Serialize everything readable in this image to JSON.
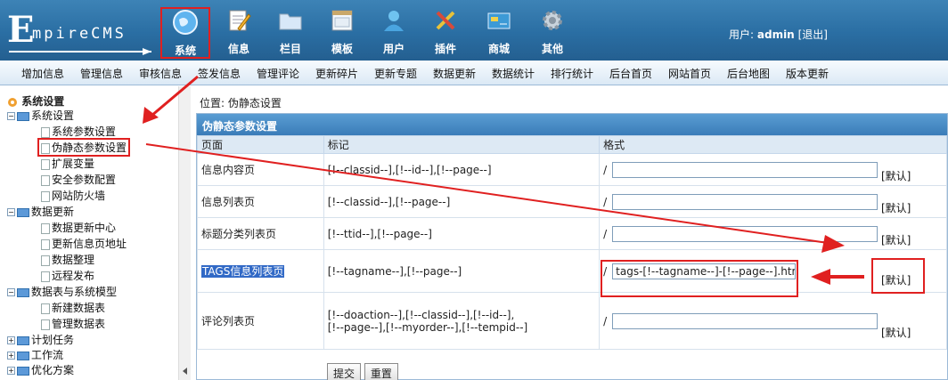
{
  "header": {
    "logo_initial": "E",
    "logo_text": "mpireCMS",
    "nav": [
      {
        "label": "系统",
        "icon": "globe-icon"
      },
      {
        "label": "信息",
        "icon": "notepad-pencil-icon"
      },
      {
        "label": "栏目",
        "icon": "folder-icon"
      },
      {
        "label": "模板",
        "icon": "window-template-icon"
      },
      {
        "label": "用户",
        "icon": "user-icon"
      },
      {
        "label": "插件",
        "icon": "tools-icon"
      },
      {
        "label": "商城",
        "icon": "shop-card-icon"
      },
      {
        "label": "其他",
        "icon": "gear-icon"
      }
    ],
    "user_label": "用户:",
    "username": "admin",
    "logout": "[退出]"
  },
  "menubar": [
    "增加信息",
    "管理信息",
    "审核信息",
    "签发信息",
    "管理评论",
    "更新碎片",
    "更新专题",
    "数据更新",
    "数据统计",
    "排行统计",
    "后台首页",
    "网站首页",
    "后台地图",
    "版本更新"
  ],
  "sidebar": {
    "root": "系统设置",
    "groups": [
      {
        "label": "系统设置",
        "items": [
          "系统参数设置",
          "伪静态参数设置",
          "扩展变量",
          "安全参数配置",
          "网站防火墙"
        ]
      },
      {
        "label": "数据更新",
        "items": [
          "数据更新中心",
          "更新信息页地址",
          "数据整理",
          "远程发布"
        ]
      },
      {
        "label": "数据表与系统模型",
        "items": [
          "新建数据表",
          "管理数据表"
        ]
      }
    ],
    "collapsed": [
      "计划任务",
      "工作流",
      "优化方案"
    ]
  },
  "main": {
    "position_label": "位置:",
    "position_link": "伪静态设置",
    "panel_title": "伪静态参数设置",
    "columns": [
      "页面",
      "标记",
      "格式"
    ],
    "rows": [
      {
        "page": "信息内容页",
        "tags": "[!--classid--],[!--id--],[!--page--]",
        "format": ""
      },
      {
        "page": "信息列表页",
        "tags": "[!--classid--],[!--page--]",
        "format": ""
      },
      {
        "page": "标题分类列表页",
        "tags": "[!--ttid--],[!--page--]",
        "format": ""
      },
      {
        "page": "TAGS信息列表页",
        "tags": "[!--tagname--],[!--page--]",
        "format": "tags-[!--tagname--]-[!--page--].html"
      },
      {
        "page": "评论列表页",
        "tags": "[!--doaction--],[!--classid--],[!--id--],",
        "tags2": "[!--page--],[!--myorder--],[!--tempid--]",
        "format": ""
      }
    ],
    "prefix": "/",
    "default_label": "[默认]",
    "submit": "提交",
    "reset": "重置"
  },
  "colors": {
    "header_bg": "#2a6ea3",
    "panel_title_bg": "#3a7cb8",
    "annotation_red": "#e02020",
    "selection_bg": "#3169c6"
  }
}
